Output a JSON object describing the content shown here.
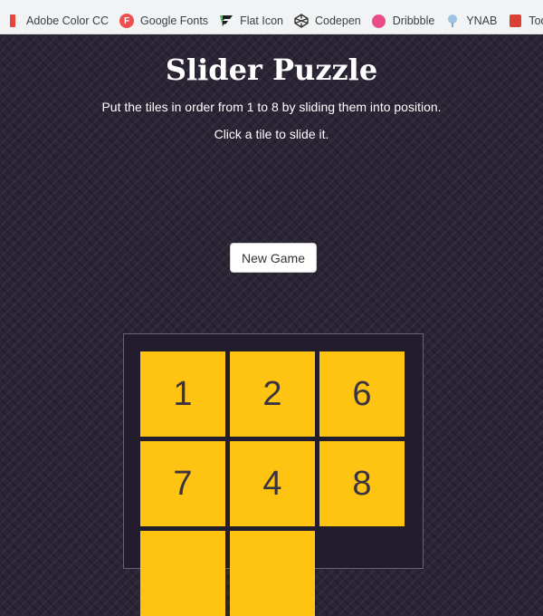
{
  "bookmarks": [
    {
      "label": "Adobe Color CC",
      "icon": "adobe-color-icon"
    },
    {
      "label": "Google Fonts",
      "icon": "google-fonts-icon"
    },
    {
      "label": "Flat Icon",
      "icon": "flaticon-icon"
    },
    {
      "label": "Codepen",
      "icon": "codepen-icon"
    },
    {
      "label": "Dribbble",
      "icon": "dribbble-icon"
    },
    {
      "label": "YNAB",
      "icon": "ynab-icon"
    },
    {
      "label": "Todoist",
      "icon": "todoist-icon"
    }
  ],
  "google_fonts_glyph": "F",
  "header": {
    "title": "Slider Puzzle",
    "subtitle": "Put the tiles in order from 1 to 8 by sliding them into position.",
    "hint": "Click a tile to slide it."
  },
  "controls": {
    "new_game_label": "New Game"
  },
  "board": {
    "tiles": [
      "1",
      "2",
      "6",
      "7",
      "4",
      "8",
      "",
      ""
    ],
    "tile_color": "#ffc312",
    "background": "#231c2c"
  }
}
